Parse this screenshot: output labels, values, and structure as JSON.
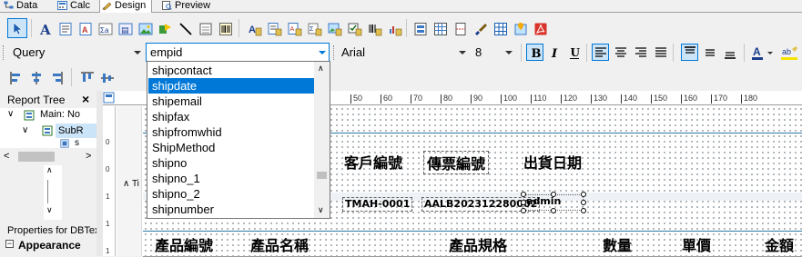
{
  "tabs": [
    {
      "label": "Data",
      "icon": "data-icon"
    },
    {
      "label": "Calc",
      "icon": "calc-icon"
    },
    {
      "label": "Design",
      "icon": "design-icon",
      "active": true
    },
    {
      "label": "Preview",
      "icon": "preview-icon"
    }
  ],
  "toolbar2": {
    "query_combo": "Query",
    "field_combo": "empid",
    "font_combo": "Arial",
    "size_combo": "8"
  },
  "field_dropdown": {
    "items": [
      "shipcontact",
      "shipdate",
      "shipemail",
      "shipfax",
      "shipfromwhid",
      "ShipMethod",
      "shipno",
      "shipno_1",
      "shipno_2",
      "shipnumber"
    ],
    "selected_index": 1
  },
  "report_tree": {
    "title": "Report Tree",
    "close": "×",
    "main_node": "Main: No",
    "sub_node": "SubR",
    "child_node": "s"
  },
  "properties": {
    "title": "Properties for DBTex",
    "section": "Appearance"
  },
  "ruler_labels": [
    "50",
    "60",
    "70",
    "80",
    "90",
    "100",
    "110",
    "120",
    "130",
    "140",
    "150",
    "160",
    "170",
    "180"
  ],
  "vruler_labels": [
    "0",
    "0",
    "1",
    "1",
    "1"
  ],
  "design": {
    "band_label": "Ti",
    "header_labels": [
      "客戶編號",
      "傳票編號",
      "出貨日期"
    ],
    "field_values": [
      "TMAH-0001",
      "AALB202312280002",
      "admin"
    ],
    "column_headers": [
      "產品編號",
      "產品名稱",
      "產品規格",
      "數量",
      "單價",
      "金額"
    ]
  },
  "colors": {
    "accent": "#0078d7",
    "pdf_red": "#d9342b"
  }
}
